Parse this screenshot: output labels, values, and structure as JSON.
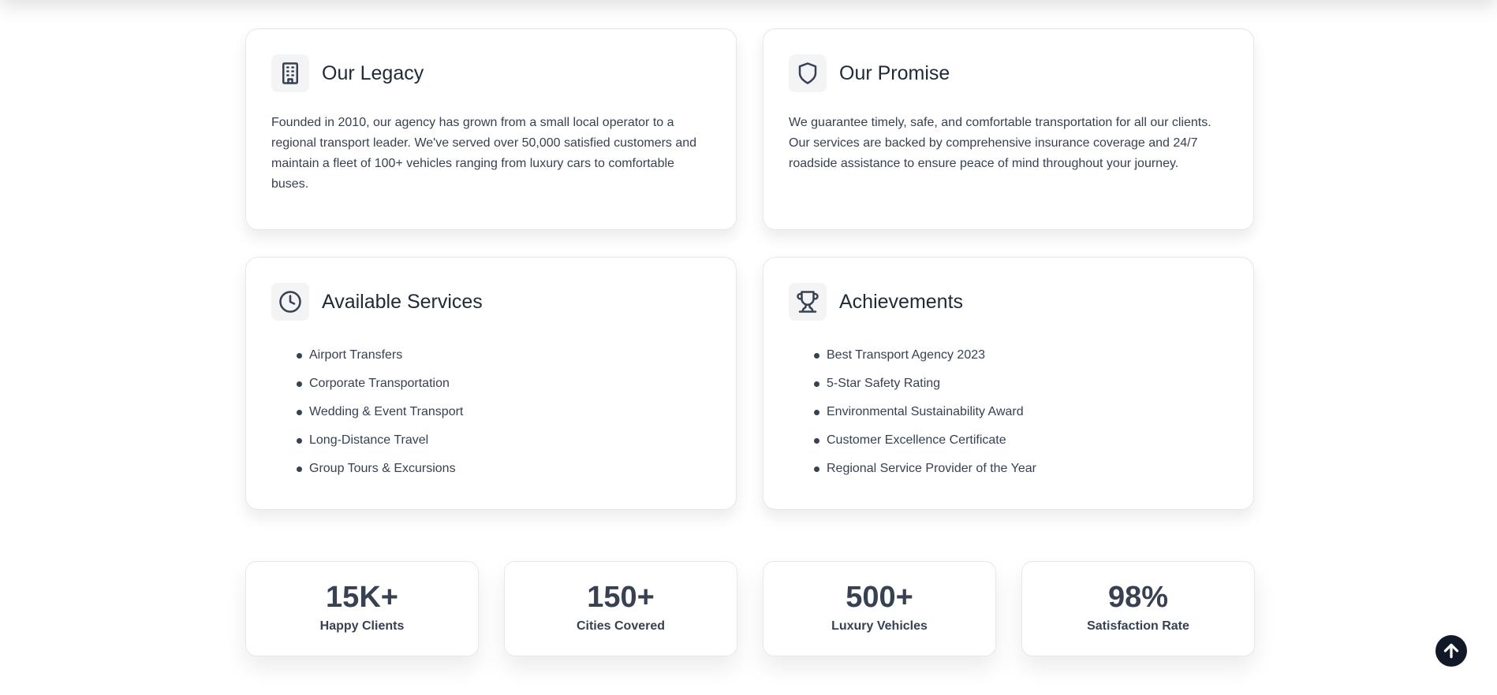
{
  "legacy": {
    "icon": "building-icon",
    "title": "Our Legacy",
    "text": "Founded in 2010, our agency has grown from a small local operator to a regional transport leader. We've served over 50,000 satisfied customers and maintain a fleet of 100+ vehicles ranging from luxury cars to comfortable buses."
  },
  "promise": {
    "icon": "shield-icon",
    "title": "Our Promise",
    "text": "We guarantee timely, safe, and comfortable transportation for all our clients. Our services are backed by comprehensive insurance coverage and 24/7 roadside assistance to ensure peace of mind throughout your journey."
  },
  "services": {
    "icon": "clock-icon",
    "title": "Available Services",
    "items": [
      "Airport Transfers",
      "Corporate Transportation",
      "Wedding & Event Transport",
      "Long-Distance Travel",
      "Group Tours & Excursions"
    ]
  },
  "achievements": {
    "icon": "trophy-icon",
    "title": "Achievements",
    "items": [
      "Best Transport Agency 2023",
      "5-Star Safety Rating",
      "Environmental Sustainability Award",
      "Customer Excellence Certificate",
      "Regional Service Provider of the Year"
    ]
  },
  "stats": [
    {
      "value": "15K+",
      "label": "Happy Clients"
    },
    {
      "value": "150+",
      "label": "Cities Covered"
    },
    {
      "value": "500+",
      "label": "Luxury Vehicles"
    },
    {
      "value": "98%",
      "label": "Satisfaction Rate"
    }
  ],
  "scroll_top": {
    "icon": "arrow-up-icon"
  },
  "colors": {
    "text": "#374151",
    "heading": "#1f2937",
    "icon_bg": "#f3f4f6",
    "border": "#e5e7eb",
    "scroll_button": "#111827"
  }
}
